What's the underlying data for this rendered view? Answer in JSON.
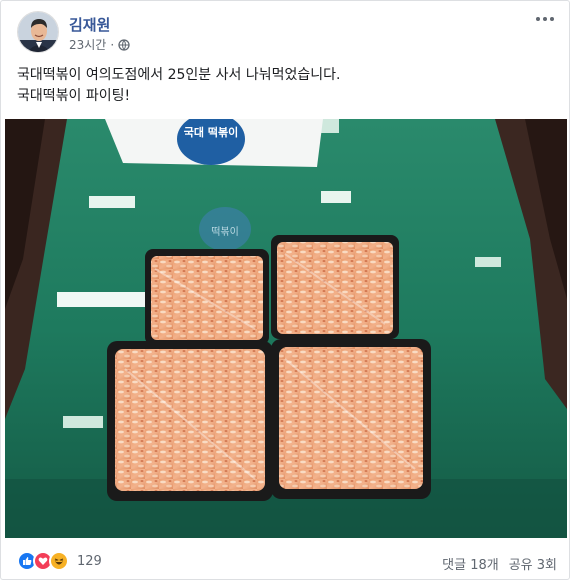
{
  "post": {
    "author": "김재원",
    "time": "23시간",
    "privacy_icon": "globe-icon",
    "more_icon": "more-options-icon",
    "lines": [
      "국대떡볶이 여의도점에서 25인분 사서 나눠먹었습니다.",
      "국대떡볶이 파이팅!"
    ]
  },
  "photo": {
    "bag_print": "국대 떡볶이",
    "reflection_print": "떡볶이"
  },
  "footer": {
    "reaction_icons": [
      "like-icon",
      "love-icon",
      "haha-icon"
    ],
    "reaction_count": "129",
    "comments": "댓글 18개",
    "shares": "공유 3회"
  },
  "colors": {
    "link": "#385898",
    "meta": "#606770",
    "table_green": "#1b6a55",
    "like_blue": "#1877f2",
    "love_red": "#f33e58",
    "haha_yellow": "#f7b125"
  }
}
